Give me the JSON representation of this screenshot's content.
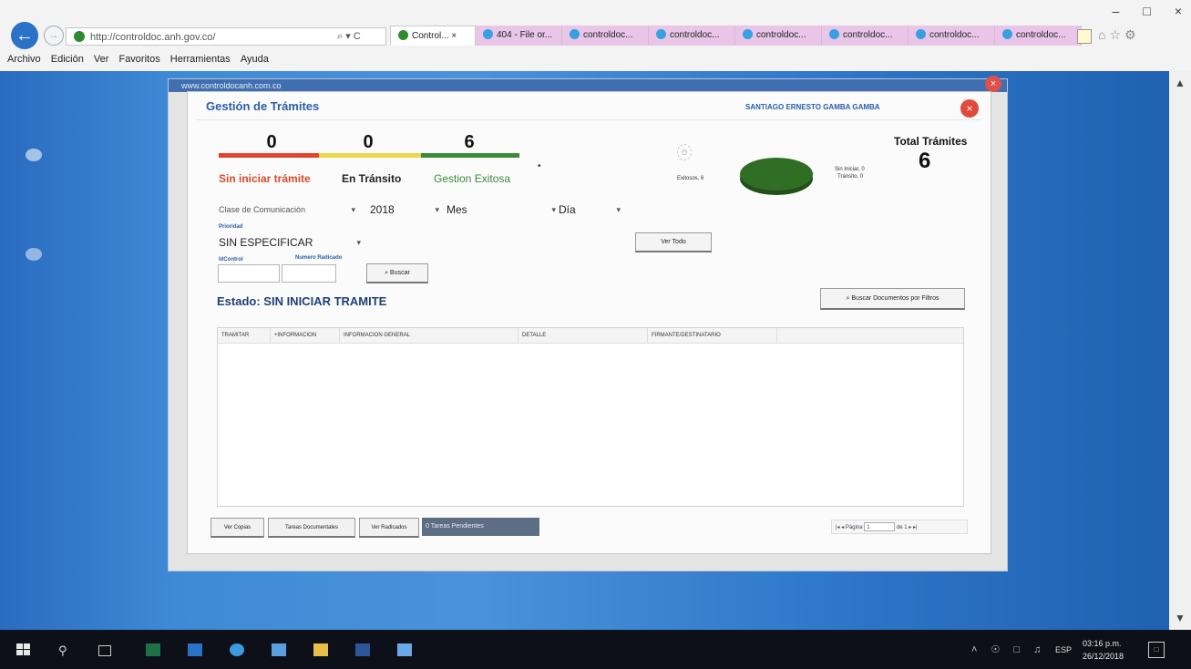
{
  "browser": {
    "url": "http://controldoc.anh.gov.co/",
    "address_tools": "⌕ ▾ C",
    "tabs": [
      {
        "label": "Control...",
        "active": true
      },
      {
        "label": "404 - File or...",
        "active": false
      },
      {
        "label": "controldoc...",
        "active": false
      },
      {
        "label": "controldoc...",
        "active": false
      },
      {
        "label": "controldoc...",
        "active": false
      },
      {
        "label": "controldoc...",
        "active": false
      },
      {
        "label": "controldoc...",
        "active": false
      },
      {
        "label": "controldoc...",
        "active": false
      }
    ],
    "tab_close": "×",
    "menu": [
      "Archivo",
      "Edición",
      "Ver",
      "Favoritos",
      "Herramientas",
      "Ayuda"
    ],
    "window_controls": {
      "minimize": "–",
      "restore": "□",
      "close": "×"
    },
    "right_icons": "⌂☆⚙"
  },
  "outer_modal": {
    "title": "www.controldocanh.com.co",
    "close": "×"
  },
  "dialog": {
    "title": "Gestión de Trámites",
    "user": "SANTIAGO ERNESTO GAMBA GAMBA",
    "close": "×",
    "counters": [
      {
        "value": "0",
        "label": "Sin iniciar trámite",
        "color": "#e0442a",
        "label_color": "#d84a2a"
      },
      {
        "value": "0",
        "label": "En Tránsito",
        "color": "#e8d84a",
        "label_color": "#222222"
      },
      {
        "value": "6",
        "label": "Gestion Exitosa",
        "color": "#3a8a3a",
        "label_color": "#3a8a3a"
      }
    ],
    "dot": "•",
    "total": {
      "label": "Total Trámites",
      "value": "6"
    },
    "pie": {
      "left_label": "Exitosos, 6",
      "right_label_1": "Sin Iniciar, 0",
      "right_label_2": "Tránsito, 0",
      "color": "#2f6e24"
    },
    "filters": {
      "clase": "Clase de Comunicación",
      "year": "2018",
      "month": "Mes",
      "day": "Día",
      "prioridad_label": "Prioridad",
      "prioridad_value": "SIN ESPECIFICAR",
      "idcontrol_label": "IdControl",
      "radicado_label": "Numero Radicado",
      "buscar": "⌕ Buscar",
      "ver_todo": "Ver Todo",
      "buscar_filtros": "⌕ Buscar Documentos por Filtros",
      "arrow": "▾"
    },
    "estado": "Estado: SIN INICIAR TRAMITE",
    "columns": [
      "TRAMITAR",
      "+INFORMACION",
      "INFORMACION GENERAL",
      "DETALLE",
      "FIRMANTE/DESTINATARIO"
    ],
    "footer": {
      "ver_copias": "Ver Copias",
      "tareas": "Tareas Documentales",
      "ver_radicados": "Ver Radicados",
      "pendientes": "0 Tareas Pendientes",
      "pager_first": "|◂ ◂",
      "pager_label": "Página",
      "page": "1",
      "of": "de 1",
      "pager_last": "▸ ▸|"
    }
  },
  "taskbar": {
    "lang": "ESP",
    "time": "03:16 p.m.",
    "date": "26/12/2018",
    "tray": "˄ ☉ □ ♫"
  }
}
